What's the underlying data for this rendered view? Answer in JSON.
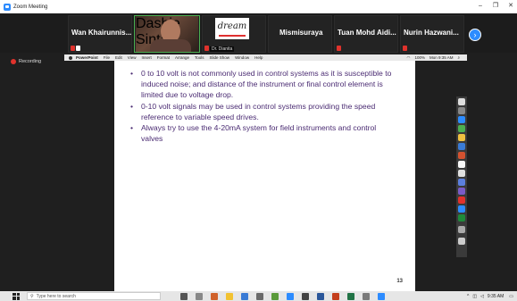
{
  "window": {
    "title": "Zoom Meeting",
    "controls": [
      "–",
      "❐",
      "✕"
    ]
  },
  "participants": [
    {
      "name": "Wan Khairunnis...",
      "type": "name"
    },
    {
      "name": "Dashie Sinta",
      "type": "video"
    },
    {
      "name": "Dr. Dianita",
      "type": "logo",
      "logo_text": "dream"
    },
    {
      "name": "Mismisuraya",
      "type": "name"
    },
    {
      "name": "Tuan Mohd Aidi...",
      "type": "name"
    },
    {
      "name": "Nurin Hazwani...",
      "type": "name"
    }
  ],
  "recording_label": "Recording",
  "mac_menu": {
    "app": "PowerPoint",
    "items": [
      "File",
      "Edit",
      "View",
      "Insert",
      "Format",
      "Arrange",
      "Tools",
      "Slide Show",
      "Window",
      "Help"
    ],
    "battery": "100%",
    "clock": "Mon 9:35 AM"
  },
  "slide": {
    "bullets": [
      "0 to 10 volt is not commonly used in control systems as it is susceptible to induced noise; and distance of the instrument or final control element is limited due to voltage drop.",
      "0-10 volt signals may be used in control systems providing the speed reference to variable speed drives.",
      "Always try to use the 4-20mA system for field instruments and control valves"
    ],
    "page_number": "13",
    "text_color": "#4b2c73"
  },
  "taskbar": {
    "search_placeholder": "Type here to search",
    "time": "9:35 AM"
  },
  "colors": {
    "zoom_blue": "#2d8cff",
    "record_red": "#e0322c"
  }
}
